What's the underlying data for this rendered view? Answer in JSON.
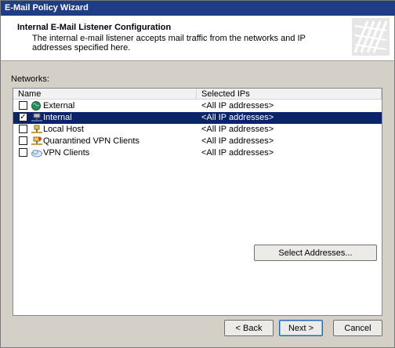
{
  "window": {
    "title": "E-Mail Policy Wizard"
  },
  "header": {
    "title": "Internal E-Mail Listener Configuration",
    "description": "The internal e-mail listener accepts mail traffic from the networks and IP addresses specified here."
  },
  "networks_label": "Networks:",
  "columns": {
    "name": "Name",
    "ips": "Selected IPs"
  },
  "rows": [
    {
      "name": "External",
      "ips": "<All IP addresses>",
      "checked": false,
      "icon": "globe-icon",
      "selected": false
    },
    {
      "name": "Internal",
      "ips": "<All IP addresses>",
      "checked": true,
      "icon": "network-icon",
      "selected": true
    },
    {
      "name": "Local Host",
      "ips": "<All IP addresses>",
      "checked": false,
      "icon": "local-host-icon",
      "selected": false
    },
    {
      "name": "Quarantined VPN Clients",
      "ips": "<All IP addresses>",
      "checked": false,
      "icon": "quarantine-network-icon",
      "selected": false
    },
    {
      "name": "VPN Clients",
      "ips": "<All IP addresses>",
      "checked": false,
      "icon": "vpn-cloud-icon",
      "selected": false
    }
  ],
  "buttons": {
    "select_addresses": "Select Addresses...",
    "back": "< Back",
    "next": "Next >",
    "cancel": "Cancel"
  },
  "colors": {
    "title_bar": "#1f3d85",
    "selection": "#0a246a",
    "dialog_bg": "#d4d0c8"
  }
}
